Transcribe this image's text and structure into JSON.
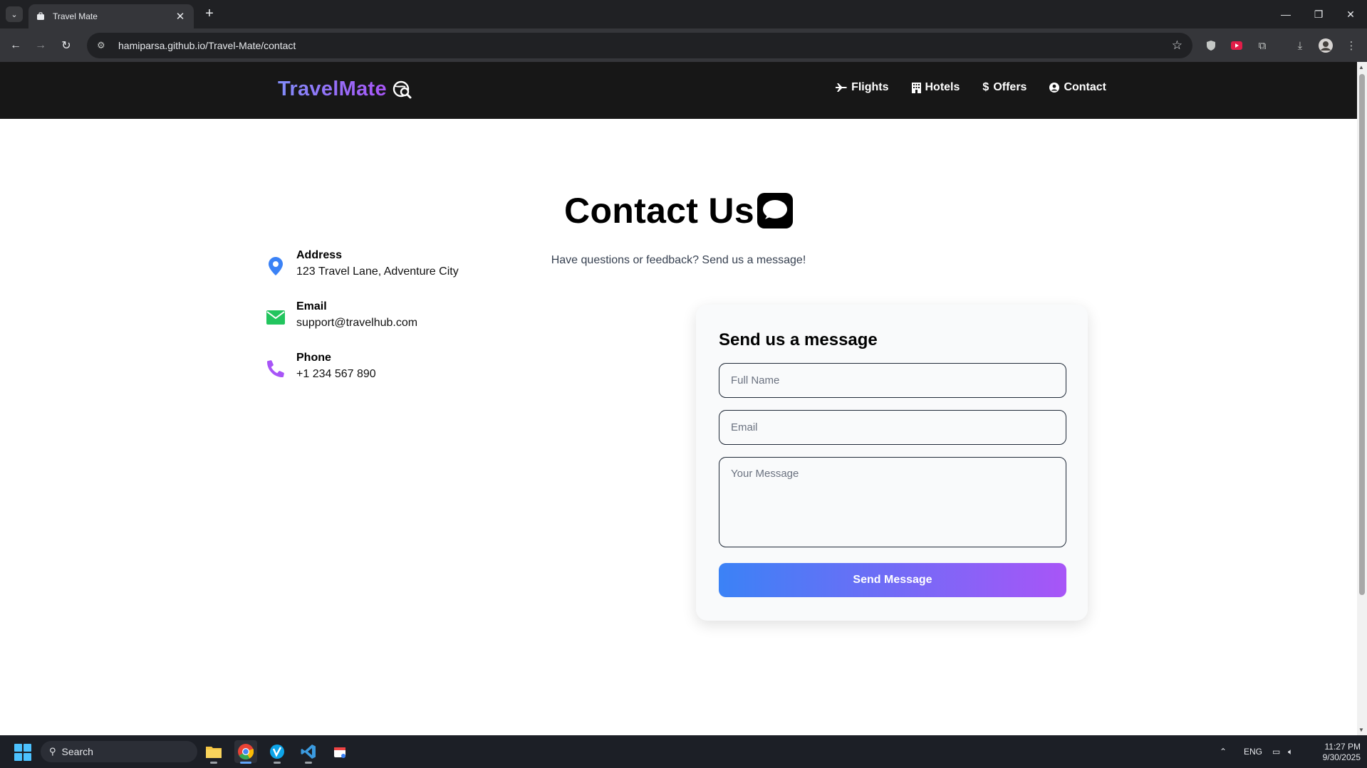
{
  "browser": {
    "tab_title": "Travel Mate",
    "url": "hamiparsa.github.io/Travel-Mate/contact"
  },
  "site": {
    "brand": "TravelMate",
    "nav": [
      {
        "label": "Flights",
        "icon": "plane-icon"
      },
      {
        "label": "Hotels",
        "icon": "hotel-icon"
      },
      {
        "label": "Offers",
        "icon": "dollar-icon"
      },
      {
        "label": "Contact",
        "icon": "user-circle-icon"
      }
    ]
  },
  "hero": {
    "title": "Contact Us",
    "subtitle": "Have questions or feedback? Send us a message!"
  },
  "contact_info": [
    {
      "label": "Address",
      "value": "123 Travel Lane, Adventure City",
      "icon": "map-pin-icon",
      "color": "#3b82f6"
    },
    {
      "label": "Email",
      "value": "support@travelhub.com",
      "icon": "envelope-icon",
      "color": "#22c55e"
    },
    {
      "label": "Phone",
      "value": "+1 234 567 890",
      "icon": "phone-icon",
      "color": "#a855f7"
    }
  ],
  "form": {
    "heading": "Send us a message",
    "name_placeholder": "Full Name",
    "email_placeholder": "Email",
    "message_placeholder": "Your Message",
    "submit_label": "Send Message"
  },
  "taskbar": {
    "search_label": "Search",
    "language": "ENG",
    "time": "11:27 PM",
    "date": "9/30/2025"
  },
  "colors": {
    "nav_bg": "#171717",
    "brand_gradient": [
      "#818cf8",
      "#a855f7"
    ],
    "button_gradient": [
      "#3b82f6",
      "#a855f7"
    ]
  }
}
